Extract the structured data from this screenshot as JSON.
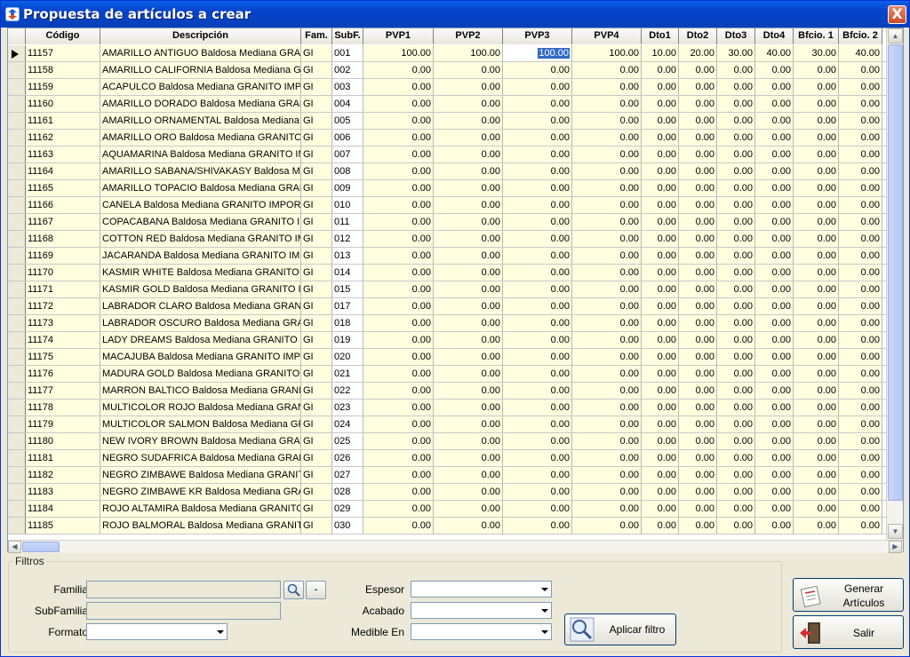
{
  "window": {
    "title": "Propuesta de artículos a crear",
    "close_label": "X"
  },
  "grid": {
    "columns": [
      "",
      "Código",
      "Descripción",
      "Fam.",
      "SubF.",
      "PVP1",
      "PVP2",
      "PVP3",
      "PVP4",
      "Dto1",
      "Dto2",
      "Dto3",
      "Dto4",
      "Bfcio. 1",
      "Bfcio. 2"
    ],
    "rows": [
      [
        "11157",
        "AMARILLO ANTIGUO Baldosa Mediana GRANI",
        "GI",
        "001",
        "100.00",
        "100.00",
        "100.00",
        "100.00",
        "10.00",
        "20.00",
        "30.00",
        "40.00",
        "30.00",
        "40.00"
      ],
      [
        "11158",
        "AMARILLO CALIFORNIA Baldosa Mediana GRA",
        "GI",
        "002",
        "0.00",
        "0.00",
        "0.00",
        "0.00",
        "0.00",
        "0.00",
        "0.00",
        "0.00",
        "0.00",
        "0.00"
      ],
      [
        "11159",
        "ACAPULCO Baldosa Mediana GRANITO IMPOR",
        "GI",
        "003",
        "0.00",
        "0.00",
        "0.00",
        "0.00",
        "0.00",
        "0.00",
        "0.00",
        "0.00",
        "0.00",
        "0.00"
      ],
      [
        "11160",
        "AMARILLO DORADO Baldosa Mediana GRANI",
        "GI",
        "004",
        "0.00",
        "0.00",
        "0.00",
        "0.00",
        "0.00",
        "0.00",
        "0.00",
        "0.00",
        "0.00",
        "0.00"
      ],
      [
        "11161",
        "AMARILLO ORNAMENTAL Baldosa Mediana G",
        "GI",
        "005",
        "0.00",
        "0.00",
        "0.00",
        "0.00",
        "0.00",
        "0.00",
        "0.00",
        "0.00",
        "0.00",
        "0.00"
      ],
      [
        "11162",
        "AMARILLO ORO Baldosa Mediana GRANITO IM",
        "GI",
        "006",
        "0.00",
        "0.00",
        "0.00",
        "0.00",
        "0.00",
        "0.00",
        "0.00",
        "0.00",
        "0.00",
        "0.00"
      ],
      [
        "11163",
        "AQUAMARINA Baldosa Mediana GRANITO IMP",
        "GI",
        "007",
        "0.00",
        "0.00",
        "0.00",
        "0.00",
        "0.00",
        "0.00",
        "0.00",
        "0.00",
        "0.00",
        "0.00"
      ],
      [
        "11164",
        "AMARILLO SABANA/SHIVAKASY Baldosa Me",
        "GI",
        "008",
        "0.00",
        "0.00",
        "0.00",
        "0.00",
        "0.00",
        "0.00",
        "0.00",
        "0.00",
        "0.00",
        "0.00"
      ],
      [
        "11165",
        "AMARILLO TOPACIO Baldosa Mediana GRANI",
        "GI",
        "009",
        "0.00",
        "0.00",
        "0.00",
        "0.00",
        "0.00",
        "0.00",
        "0.00",
        "0.00",
        "0.00",
        "0.00"
      ],
      [
        "11166",
        "CANELA Baldosa Mediana GRANITO IMPORT. I",
        "GI",
        "010",
        "0.00",
        "0.00",
        "0.00",
        "0.00",
        "0.00",
        "0.00",
        "0.00",
        "0.00",
        "0.00",
        "0.00"
      ],
      [
        "11167",
        "COPACABANA Baldosa Mediana GRANITO IMP",
        "GI",
        "011",
        "0.00",
        "0.00",
        "0.00",
        "0.00",
        "0.00",
        "0.00",
        "0.00",
        "0.00",
        "0.00",
        "0.00"
      ],
      [
        "11168",
        "COTTON RED Baldosa Mediana GRANITO IMPO",
        "GI",
        "012",
        "0.00",
        "0.00",
        "0.00",
        "0.00",
        "0.00",
        "0.00",
        "0.00",
        "0.00",
        "0.00",
        "0.00"
      ],
      [
        "11169",
        "JACARANDA Baldosa Mediana GRANITO IMPO",
        "GI",
        "013",
        "0.00",
        "0.00",
        "0.00",
        "0.00",
        "0.00",
        "0.00",
        "0.00",
        "0.00",
        "0.00",
        "0.00"
      ],
      [
        "11170",
        "KASMIR WHITE Baldosa Mediana GRANITO IMP",
        "GI",
        "014",
        "0.00",
        "0.00",
        "0.00",
        "0.00",
        "0.00",
        "0.00",
        "0.00",
        "0.00",
        "0.00",
        "0.00"
      ],
      [
        "11171",
        "KASMIR GOLD Baldosa Mediana GRANITO IMP",
        "GI",
        "015",
        "0.00",
        "0.00",
        "0.00",
        "0.00",
        "0.00",
        "0.00",
        "0.00",
        "0.00",
        "0.00",
        "0.00"
      ],
      [
        "11172",
        "LABRADOR CLARO Baldosa Mediana GRANIT",
        "GI",
        "017",
        "0.00",
        "0.00",
        "0.00",
        "0.00",
        "0.00",
        "0.00",
        "0.00",
        "0.00",
        "0.00",
        "0.00"
      ],
      [
        "11173",
        "LABRADOR OSCURO Baldosa Mediana GRAN",
        "GI",
        "018",
        "0.00",
        "0.00",
        "0.00",
        "0.00",
        "0.00",
        "0.00",
        "0.00",
        "0.00",
        "0.00",
        "0.00"
      ],
      [
        "11174",
        "LADY DREAMS Baldosa Mediana GRANITO IM",
        "GI",
        "019",
        "0.00",
        "0.00",
        "0.00",
        "0.00",
        "0.00",
        "0.00",
        "0.00",
        "0.00",
        "0.00",
        "0.00"
      ],
      [
        "11175",
        "MACAJUBA Baldosa Mediana GRANITO IMPOR",
        "GI",
        "020",
        "0.00",
        "0.00",
        "0.00",
        "0.00",
        "0.00",
        "0.00",
        "0.00",
        "0.00",
        "0.00",
        "0.00"
      ],
      [
        "11176",
        "MADURA GOLD Baldosa Mediana GRANITO IM",
        "GI",
        "021",
        "0.00",
        "0.00",
        "0.00",
        "0.00",
        "0.00",
        "0.00",
        "0.00",
        "0.00",
        "0.00",
        "0.00"
      ],
      [
        "11177",
        "MARRON BALTICO Baldosa Mediana GRANITO",
        "GI",
        "022",
        "0.00",
        "0.00",
        "0.00",
        "0.00",
        "0.00",
        "0.00",
        "0.00",
        "0.00",
        "0.00",
        "0.00"
      ],
      [
        "11178",
        "MULTICOLOR ROJO Baldosa Mediana GRANIT",
        "GI",
        "023",
        "0.00",
        "0.00",
        "0.00",
        "0.00",
        "0.00",
        "0.00",
        "0.00",
        "0.00",
        "0.00",
        "0.00"
      ],
      [
        "11179",
        "MULTICOLOR SALMON Baldosa Mediana GRA",
        "GI",
        "024",
        "0.00",
        "0.00",
        "0.00",
        "0.00",
        "0.00",
        "0.00",
        "0.00",
        "0.00",
        "0.00",
        "0.00"
      ],
      [
        "11180",
        "NEW IVORY BROWN Baldosa Mediana GRANI",
        "GI",
        "025",
        "0.00",
        "0.00",
        "0.00",
        "0.00",
        "0.00",
        "0.00",
        "0.00",
        "0.00",
        "0.00",
        "0.00"
      ],
      [
        "11181",
        "NEGRO SUDAFRICA Baldosa Mediana GRANIT",
        "GI",
        "026",
        "0.00",
        "0.00",
        "0.00",
        "0.00",
        "0.00",
        "0.00",
        "0.00",
        "0.00",
        "0.00",
        "0.00"
      ],
      [
        "11182",
        "NEGRO ZIMBAWE Baldosa Mediana GRANITO",
        "GI",
        "027",
        "0.00",
        "0.00",
        "0.00",
        "0.00",
        "0.00",
        "0.00",
        "0.00",
        "0.00",
        "0.00",
        "0.00"
      ],
      [
        "11183",
        "NEGRO ZIMBAWE KR Baldosa Mediana GRANI",
        "GI",
        "028",
        "0.00",
        "0.00",
        "0.00",
        "0.00",
        "0.00",
        "0.00",
        "0.00",
        "0.00",
        "0.00",
        "0.00"
      ],
      [
        "11184",
        "ROJO ALTAMIRA Baldosa Mediana GRANITO I",
        "GI",
        "029",
        "0.00",
        "0.00",
        "0.00",
        "0.00",
        "0.00",
        "0.00",
        "0.00",
        "0.00",
        "0.00",
        "0.00"
      ],
      [
        "11185",
        "ROJO BALMORAL Baldosa Mediana GRANITO",
        "GI",
        "030",
        "0.00",
        "0.00",
        "0.00",
        "0.00",
        "0.00",
        "0.00",
        "0.00",
        "0.00",
        "0.00",
        "0.00"
      ]
    ],
    "current_row": 0,
    "selected_cell_col": 6
  },
  "filters": {
    "legend": "Filtros",
    "familia_label": "Familia",
    "subfamilia_label": "SubFamilia",
    "formato_label": "Formato",
    "espesor_label": "Espesor",
    "acabado_label": "Acabado",
    "medible_label": "Medible En",
    "clear_label": "-",
    "apply_label": "Aplicar filtro"
  },
  "actions": {
    "generar_line1": "Generar",
    "generar_line2": "Artículos",
    "salir_label": "Salir"
  }
}
